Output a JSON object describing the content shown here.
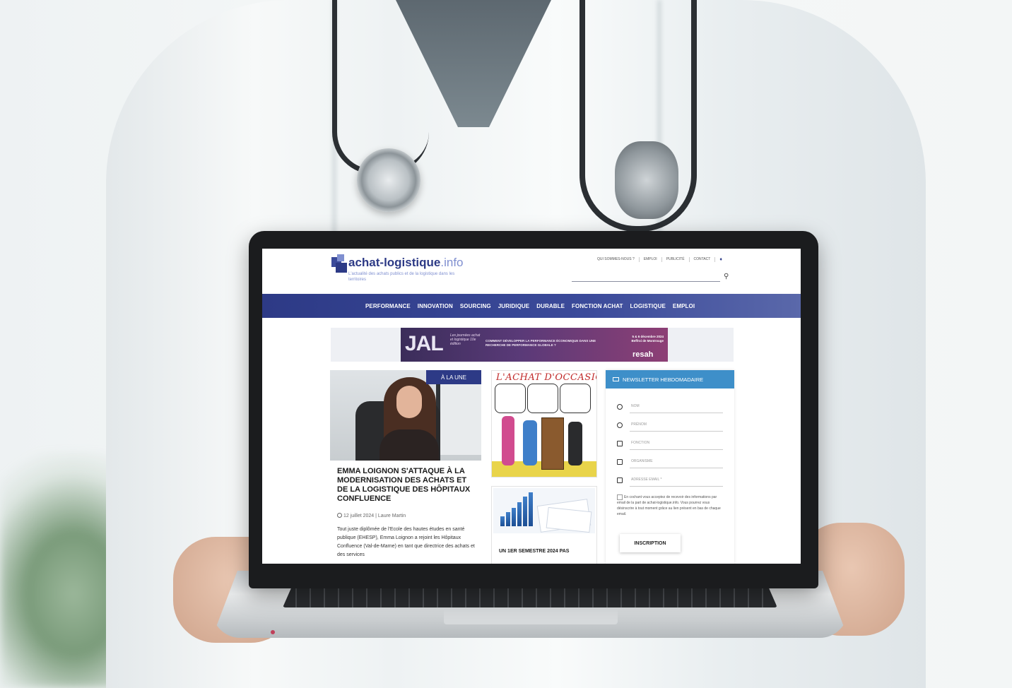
{
  "site": {
    "logo_main": "achat-logistique",
    "logo_tld": ".info",
    "tagline": "L'actualité des achats publics et de la logistique dans les territoires"
  },
  "top_links": [
    "QUI SOMMES-NOUS ?",
    "EMPLOI",
    "PUBLICITÉ",
    "CONTACT"
  ],
  "nav": [
    "PERFORMANCE",
    "INNOVATION",
    "SOURCING",
    "JURIDIQUE",
    "DURABLE",
    "FONCTION ACHAT",
    "LOGISTIQUE",
    "EMPLOI"
  ],
  "banner": {
    "jal": "JAL",
    "jal_sub": "Les journées achat et logistique 10e édition",
    "headline": "COMMENT DÉVELOPPER LA PERFORMANCE ÉCONOMIQUE DANS UNE RECHERCHE DE PERFORMANCE GLOBALE ?",
    "dates": "5 & 6 décembre 2024 Beffroi de Montrouge",
    "brand": "resah"
  },
  "featured": {
    "badge": "À LA UNE",
    "title": "EMMA LOIGNON S'ATTAQUE À LA MODERNISATION DES ACHATS ET DE LA LOGISTIQUE DES HÔPITAUX CONFLUENCE",
    "meta": "12 juillet 2024 | Laure Martin",
    "excerpt": "Tout juste diplômée de l'Ecole des hautes études en santé publique (EHESP), Emma Loignon a rejoint les Hôpitaux Confluence (Val-de-Marne) en tant que directrice des achats et des services"
  },
  "cartoon": {
    "title": "L'ACHAT D'OCCASION"
  },
  "second_article": {
    "title": "UN 1ER SEMESTRE 2024 PAS"
  },
  "newsletter": {
    "title": "NEWSLETTER HEBDOMADAIRE",
    "fields": [
      "NOM",
      "PRÉNOM",
      "FONCTION",
      "ORGANISME",
      "ADRESSE EMAIL *"
    ],
    "consent": "En cochant vous acceptez de recevoir des informations par email de la part de achat-logistique.info. Vous pourrez vous désinscrire à tout moment grâce au lien présent en bas de chaque email.",
    "button": "INSCRIPTION"
  },
  "colors": {
    "brand": "#2d3a86",
    "accent": "#3e8fc9",
    "cartoon_red": "#c12a2a"
  }
}
